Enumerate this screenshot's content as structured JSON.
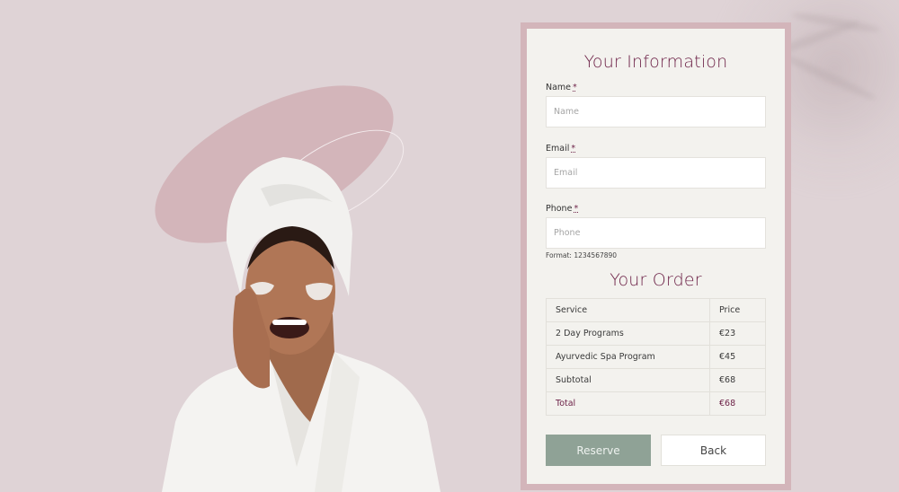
{
  "form": {
    "info_title": "Your Information",
    "required_marker": "*",
    "fields": [
      {
        "label": "Name",
        "placeholder": "Name",
        "value": ""
      },
      {
        "label": "Email",
        "placeholder": "Email",
        "value": ""
      },
      {
        "label": "Phone",
        "placeholder": "Phone",
        "value": ""
      }
    ],
    "phone_hint": "Format: 1234567890"
  },
  "order": {
    "title": "Your Order",
    "headers": {
      "service": "Service",
      "price": "Price"
    },
    "rows": [
      {
        "service": "2 Day Programs",
        "price": "€23"
      },
      {
        "service": "Ayurvedic Spa Program",
        "price": "€45"
      },
      {
        "service": "Subtotal",
        "price": "€68"
      }
    ],
    "total": {
      "label": "Total",
      "price": "€68"
    }
  },
  "buttons": {
    "reserve": "Reserve",
    "back": "Back"
  },
  "colors": {
    "background": "#dfd3d6",
    "card_border": "#d3b5ba",
    "card_bg": "#f3f2ee",
    "accent": "#6b1f45",
    "reserve_button": "#8fa296"
  }
}
